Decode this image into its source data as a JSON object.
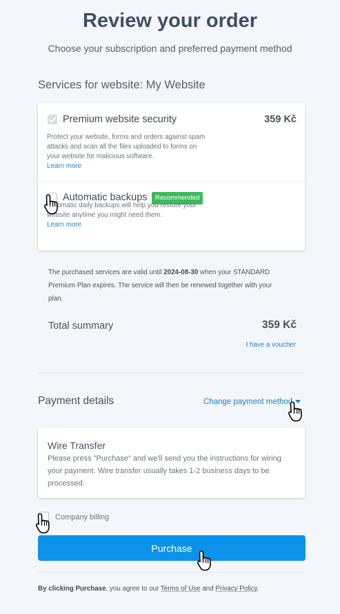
{
  "header": {
    "title": "Review your order",
    "subtitle": "Choose your subscription and preferred payment method"
  },
  "services": {
    "section_title": "Services for website: My Website",
    "items": [
      {
        "name": "Premium website security",
        "price": "359 Kč",
        "checked": true,
        "description": "Protect your website, forms and orders against spam attacks and scan all the files uploaded to forms on your website for malicious software.",
        "learn_more": "Learn more"
      },
      {
        "name": "Automatic backups",
        "badge": "Recommended",
        "checked": false,
        "description": "Automatic daily backups will help you restore your website anytime you might need them.",
        "learn_more": "Learn more"
      }
    ]
  },
  "validity_note": {
    "before": "The purchased services are valid until ",
    "date": "2024-08-30",
    "after": " when your STANDARD Premium Plan expires. The service will then be renewed together with your plan."
  },
  "summary": {
    "label": "Total summary",
    "value": "359 Kč",
    "voucher_link": "I have a voucher"
  },
  "payment": {
    "title": "Payment details",
    "change_link": "Change payment method",
    "method_title": "Wire Transfer",
    "method_description": "Please press \"Purchase\" and we'll send you the instructions for wiring your payment. Wire transfer usually takes 1-2 business days to be processed.",
    "company_billing_label": "Company billing",
    "company_billing_checked": false
  },
  "purchase_button": "Purchase",
  "terms": {
    "bold": "By clicking Purchase",
    "middle": ", you agree to our ",
    "terms_link": "Terms of Use",
    "and": " and ",
    "privacy_link": "Privacy Policy",
    "end": "."
  },
  "colors": {
    "accent": "#0b93ea",
    "link": "#1f7fc9",
    "badge": "#3dba5d",
    "title": "#3e4f66",
    "background": "#f3f6fa"
  }
}
